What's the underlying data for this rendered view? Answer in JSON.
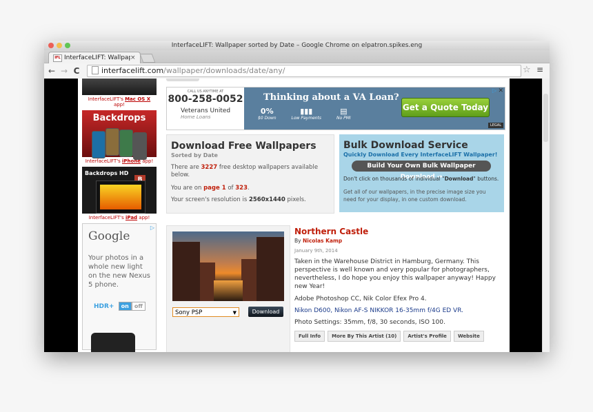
{
  "window": {
    "title": "InterfaceLIFT: Wallpaper sorted by Date – Google Chrome on elpatron.spikes.eng",
    "light_colors": [
      "#ec5f57",
      "#f4bf4f",
      "#61c554"
    ]
  },
  "tab": {
    "favicon_text": "IFL",
    "title": "InterfaceLIFT: Wallpape",
    "close": "×"
  },
  "toolbar": {
    "back": "←",
    "forward": "→",
    "reload": "C",
    "url_host": "interfacelift.com",
    "url_path": "/wallpaper/downloads/date/any/",
    "star": "☆",
    "menu": "≡"
  },
  "sidebar": {
    "macos_label_prefix": "InterfaceLIFT's ",
    "macos_link": "Mac OS X",
    "macos_label_suffix": " app!",
    "backdrops_title": "Backdrops",
    "iphone_label_prefix": "InterfaceLIFT's ",
    "iphone_link": "iPhone",
    "iphone_label_suffix": " app!",
    "hd_title": "Backdrops HD",
    "ipad_label_prefix": "InterfaceLIFT's ",
    "ipad_link": "iPad",
    "ipad_label_suffix": " app!",
    "google_ad": {
      "logo": "Google",
      "text": "Your photos in a whole new light on the new Nexus 5 phone.",
      "hdr": "HDR+",
      "on": "on",
      "off": "off"
    }
  },
  "va_ad": {
    "small": "CALL US ANYTIME AT",
    "phone": "800-258-0052",
    "logo": "Veterans United",
    "logo_sub": "Home Loans",
    "headline": "Thinking about a VA Loan?",
    "features": [
      {
        "glyph": "0%",
        "label": "$0 Down"
      },
      {
        "glyph": "▮▮▮",
        "label": "Low Payments"
      },
      {
        "glyph": "▤",
        "label": "No PMI"
      }
    ],
    "cta": "Get a Quote Today",
    "legal": "LEGAL",
    "close": "✕",
    "adchoice": "▷"
  },
  "download_box": {
    "title": "Download Free Wallpapers",
    "subtitle": "Sorted by Date",
    "p1_prefix": "There are ",
    "count": "3227",
    "p1_suffix": " free desktop wallpapers available below.",
    "p2_prefix": "You are on ",
    "page": "page 1",
    "p2_mid": " of ",
    "total_pages": "323",
    "p2_suffix": ".",
    "p3_prefix": "Your screen's resolution is ",
    "resolution": "2560x1440",
    "p3_suffix": " pixels."
  },
  "bulk_box": {
    "title": "Bulk Download Service",
    "subtitle": "Quickly Download Every InterfaceLIFT Wallpaper!",
    "button": "Build Your Own Bulk Wallpaper Download →",
    "p1_prefix": "Don't click on thousands of individual \"",
    "p1_bold": "Download",
    "p1_suffix": "\" buttons.",
    "p2": "Get all of our wallpapers, in the precise image size you need for your display, in one custom download."
  },
  "wallpaper": {
    "title": "Northern Castle",
    "by_prefix": "By ",
    "author": "Nicolas Kamp",
    "date": "January 9th, 2014",
    "description": "Taken in the Warehouse District in Hamburg, Germany. This perspective is well known and very popular for photographers, nevertheless, I do hope you enjoy this wallpaper anyway! Happy new Year!",
    "software": "Adobe Photoshop CC, Nik Color Efex Pro 4.",
    "gear": "Nikon D600, Nikon AF-S NIKKOR 16-35mm f/4G ED VR.",
    "settings": "Photo Settings: 35mm, f/8, 30 seconds, ISO 100.",
    "selected_resolution": "Sony PSP",
    "select_arrow": "▼",
    "download_label": "Download",
    "buttons": [
      "Full Info",
      "More By This Artist (10)",
      "Artist's Profile",
      "Website"
    ]
  }
}
